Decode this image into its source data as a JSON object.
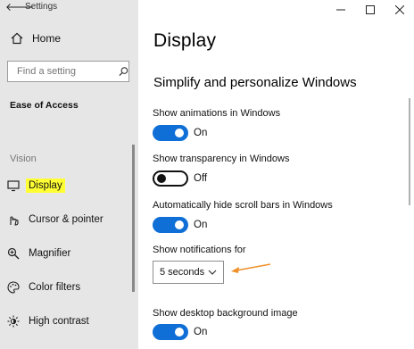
{
  "app": {
    "title": "Settings"
  },
  "sidebar": {
    "home_label": "Home",
    "search_placeholder": "Find a setting",
    "section_heading": "Ease of Access",
    "group_label": "Vision",
    "items": [
      {
        "label": "Display",
        "selected": true
      },
      {
        "label": "Cursor & pointer"
      },
      {
        "label": "Magnifier"
      },
      {
        "label": "Color filters"
      },
      {
        "label": "High contrast"
      }
    ]
  },
  "main": {
    "title": "Display",
    "subheading": "Simplify and personalize Windows",
    "settings": [
      {
        "label": "Show animations in Windows",
        "state": "On",
        "on": true
      },
      {
        "label": "Show transparency in Windows",
        "state": "Off",
        "on": false
      },
      {
        "label": "Automatically hide scroll bars in Windows",
        "state": "On",
        "on": true
      }
    ],
    "notifications": {
      "label": "Show notifications for",
      "value": "5 seconds"
    },
    "desktop_background": {
      "label": "Show desktop background image",
      "state": "On",
      "on": true
    }
  },
  "colors": {
    "accent": "#0f6fd6",
    "highlight": "#ffff33",
    "annotation_arrow": "#f0902a",
    "sidebar_bg": "#e6e6e6"
  }
}
